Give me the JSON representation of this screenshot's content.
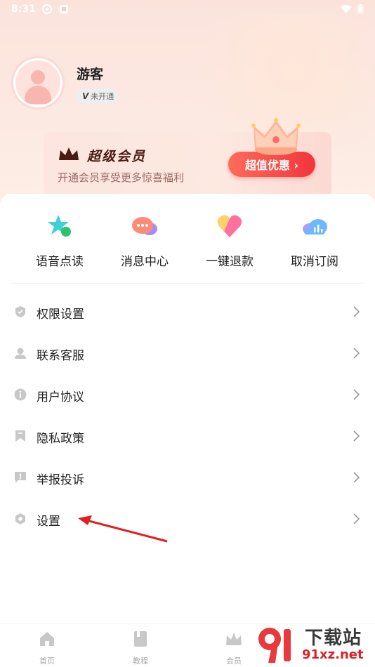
{
  "status_bar": {
    "time": "8:31"
  },
  "profile": {
    "name": "游客",
    "vip_status": "未开通",
    "vip_letter": "V"
  },
  "vip_card": {
    "title": "超级会员",
    "subtitle": "开通会员享受更多惊喜福利",
    "button": "超值优惠 ›"
  },
  "quick_actions": [
    {
      "label": "语音点读",
      "icon": "star-voice-icon"
    },
    {
      "label": "消息中心",
      "icon": "chat-bubble-icon"
    },
    {
      "label": "一键退款",
      "icon": "heart-refund-icon"
    },
    {
      "label": "取消订阅",
      "icon": "cloud-chart-icon"
    }
  ],
  "menu": [
    {
      "label": "权限设置",
      "icon": "shield-icon"
    },
    {
      "label": "联系客服",
      "icon": "support-agent-icon"
    },
    {
      "label": "用户协议",
      "icon": "info-icon"
    },
    {
      "label": "隐私政策",
      "icon": "bookmark-icon"
    },
    {
      "label": "举报投诉",
      "icon": "report-icon"
    },
    {
      "label": "设置",
      "icon": "hexagon-gear-icon"
    }
  ],
  "tabbar": [
    {
      "label": "首页",
      "icon": "home-icon"
    },
    {
      "label": "教程",
      "icon": "book-icon"
    },
    {
      "label": "会员",
      "icon": "crown-icon"
    }
  ],
  "watermark": {
    "line1": "下载站",
    "line2": "91xz.net"
  },
  "colors": {
    "accent_red": "#f2353c",
    "vip_brown": "#4a1a14",
    "menu_icon_gray": "#c8c8c8"
  }
}
